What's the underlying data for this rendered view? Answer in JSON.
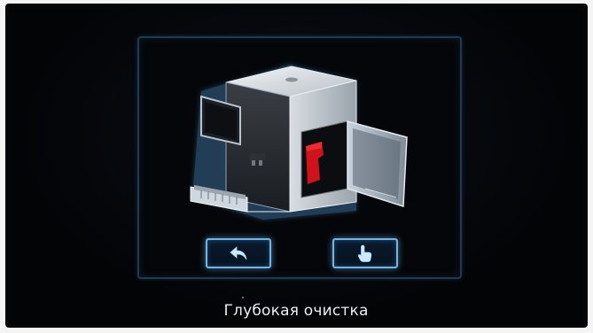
{
  "screen": {
    "caption": "Глубокая очистка"
  },
  "buttons": {
    "back_icon": "back-arrow-icon",
    "confirm_icon": "hand-touch-icon"
  },
  "illustration": {
    "icon": "coffee-machine-open-door-icon",
    "accent_color": "#d0121a"
  },
  "colors": {
    "button_glow": "#6fb6e8",
    "panel_border": "#1f3a52",
    "text": "#e8eef6"
  }
}
